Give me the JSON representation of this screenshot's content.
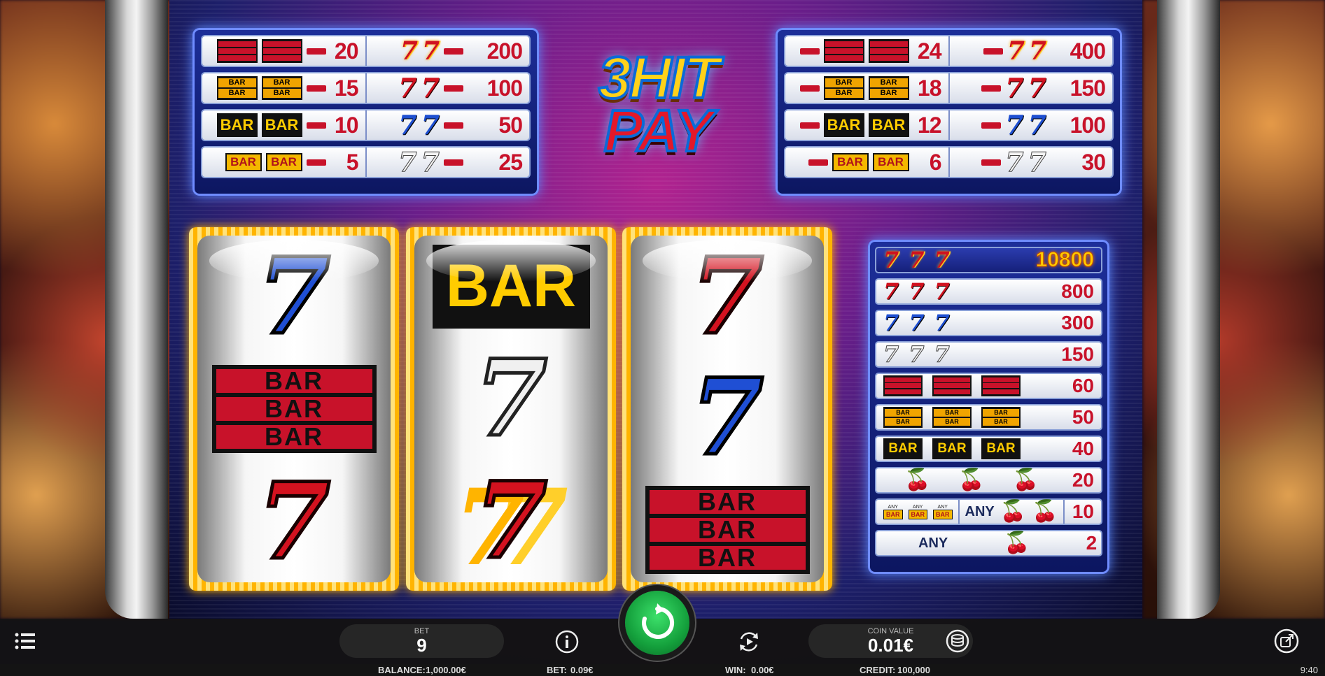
{
  "logo": {
    "top": "3HIT",
    "bottom": "PAY"
  },
  "paytable_left": [
    {
      "left_value": "20",
      "right_value": "200"
    },
    {
      "left_value": "15",
      "right_value": "100"
    },
    {
      "left_value": "10",
      "right_value": "50"
    },
    {
      "left_value": "5",
      "right_value": "25"
    }
  ],
  "paytable_right": [
    {
      "left_value": "24",
      "right_value": "400"
    },
    {
      "left_value": "18",
      "right_value": "150"
    },
    {
      "left_value": "12",
      "right_value": "100"
    },
    {
      "left_value": "6",
      "right_value": "30"
    }
  ],
  "paytable_three": [
    {
      "value": "10800"
    },
    {
      "value": "800"
    },
    {
      "value": "300"
    },
    {
      "value": "150"
    },
    {
      "value": "60"
    },
    {
      "value": "50"
    },
    {
      "value": "40"
    },
    {
      "value": "20"
    },
    {
      "value": "10",
      "any_label": "ANY",
      "any_small": "ANY"
    },
    {
      "value": "2",
      "any_label": "ANY"
    }
  ],
  "reels": [
    [
      "blue-seven",
      "triple-bar",
      "red-seven"
    ],
    [
      "single-bar",
      "white-seven",
      "fire-seven"
    ],
    [
      "red-seven",
      "blue-seven",
      "triple-bar"
    ]
  ],
  "bar_text": "BAR",
  "seven_text": "7",
  "controls": {
    "bet_label": "BET",
    "bet_value": "9",
    "coin_label": "COIN VALUE",
    "coin_value": "0.01€"
  },
  "status": {
    "balance_label": "BALANCE:",
    "balance_value": "1,000.00€",
    "bet_label": "BET:",
    "bet_value": "0.09€",
    "win_label": "WIN:",
    "win_value": "0.00€",
    "credit_label": "CREDIT:",
    "credit_value": "100,000",
    "time": "9:40"
  },
  "icons": {
    "menu": "menu-icon",
    "info": "info-icon",
    "spin": "spin-icon",
    "autoplay": "autoplay-icon",
    "coins": "coins-icon",
    "external": "external-link-icon"
  }
}
